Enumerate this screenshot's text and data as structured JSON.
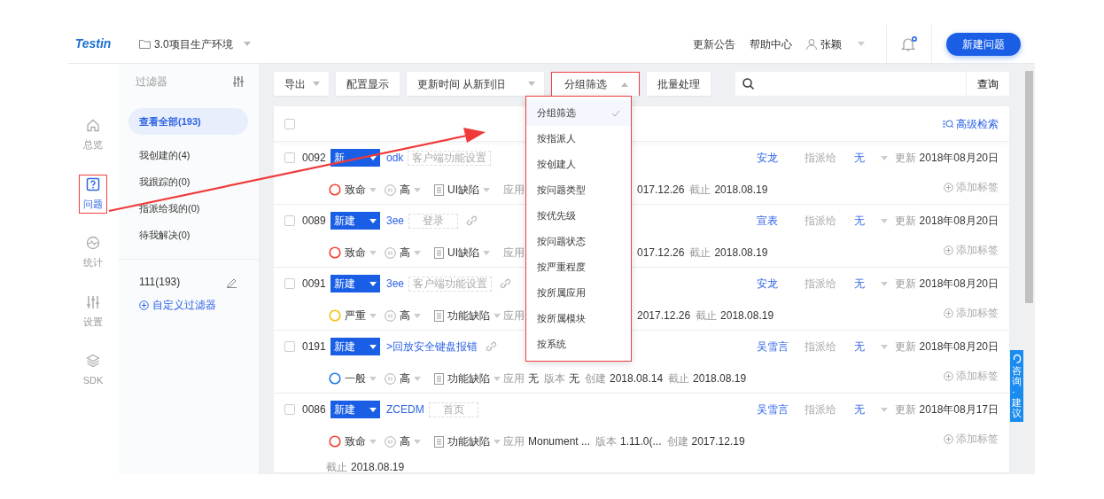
{
  "header": {
    "logo": "Testin",
    "project": "3.0项目生产环境",
    "links": [
      "更新公告",
      "帮助中心"
    ],
    "user": "张颖",
    "notification_dot": true,
    "new_button": "新建问题"
  },
  "nav": [
    {
      "label": "总览",
      "selected": false,
      "highlighted": false
    },
    {
      "label": "问题",
      "selected": true,
      "highlighted": true
    },
    {
      "label": "统计",
      "selected": false,
      "highlighted": false
    },
    {
      "label": "设置",
      "selected": false,
      "highlighted": false
    },
    {
      "label": "SDK",
      "selected": false,
      "highlighted": false
    }
  ],
  "filters": {
    "title": "过滤器",
    "items": [
      {
        "label": "查看全部(193)",
        "selected": true
      },
      {
        "label": "我创建的(4)",
        "selected": false
      },
      {
        "label": "我跟踪的(0)",
        "selected": false
      },
      {
        "label": "指派给我的(0)",
        "selected": false
      },
      {
        "label": "待我解决(0)",
        "selected": false
      }
    ],
    "custom": [
      {
        "label": "111(193)"
      }
    ],
    "add_label": "自定义过滤器"
  },
  "toolbar": {
    "buttons": [
      {
        "label": "导出",
        "kind": "dropdown"
      },
      {
        "label": "配置显示",
        "kind": "plain"
      },
      {
        "label": "更新时间 从新到旧",
        "kind": "dropdown"
      },
      {
        "label": "分组筛选",
        "kind": "open"
      },
      {
        "label": "批量处理",
        "kind": "plain"
      }
    ],
    "search_button": "查询",
    "advanced_search": "高级检索",
    "select_all_checked": false
  },
  "group_menu": {
    "highlighted": true,
    "items": [
      {
        "label": "分组筛选",
        "selected": true
      },
      {
        "label": "按指派人",
        "selected": false
      },
      {
        "label": "按创建人",
        "selected": false
      },
      {
        "label": "按问题类型",
        "selected": false
      },
      {
        "label": "按优先级",
        "selected": false
      },
      {
        "label": "按问题状态",
        "selected": false
      },
      {
        "label": "按严重程度",
        "selected": false
      },
      {
        "label": "按所属应用",
        "selected": false
      },
      {
        "label": "按所属模块",
        "selected": false
      },
      {
        "label": "按系统",
        "selected": false
      }
    ]
  },
  "issues": [
    {
      "checked": false,
      "id": "0092",
      "status": "新",
      "title": "odk",
      "module": "客户端功能设置",
      "link": false,
      "severity": {
        "label": "致命",
        "color": "#f5412e"
      },
      "priority": "高",
      "type": "UI缺陷",
      "meta": [
        {
          "label": "应用"
        },
        {
          "value": "017.12.26",
          "after_menu": true
        },
        {
          "label": "截止",
          "value": "2018.08.19",
          "after_menu": true
        }
      ],
      "assignee": "安龙",
      "assign_label": "指派给",
      "assigned": "无",
      "updated_label": "更新",
      "updated": "2018年08月20日",
      "add_tag": "添加标签"
    },
    {
      "checked": false,
      "id": "0089",
      "status": "新建",
      "title": "3ee",
      "module": "登录",
      "link": true,
      "severity": {
        "label": "致命",
        "color": "#f5412e"
      },
      "priority": "高",
      "type": "UI缺陷",
      "meta": [
        {
          "label": "应用"
        },
        {
          "value": "017.12.26",
          "after_menu": true
        },
        {
          "label": "截止",
          "value": "2018.08.19",
          "after_menu": true
        }
      ],
      "assignee": "宣表",
      "assign_label": "指派给",
      "assigned": "无",
      "updated_label": "更新",
      "updated": "2018年08月20日",
      "add_tag": "添加标签"
    },
    {
      "checked": false,
      "id": "0091",
      "status": "新建",
      "title": "3ee",
      "module": "客户端功能设置",
      "link": true,
      "severity": {
        "label": "严重",
        "color": "#fabe0a"
      },
      "priority": "高",
      "type": "功能缺陷",
      "meta": [
        {
          "label": "应用"
        },
        {
          "value": "2017.12.26",
          "after_menu": true
        },
        {
          "label": "截止",
          "value": "2018.08.19",
          "after_menu": true
        }
      ],
      "assignee": "安龙",
      "assign_label": "指派给",
      "assigned": "无",
      "updated_label": "更新",
      "updated": "2018年08月20日",
      "add_tag": "添加标签"
    },
    {
      "checked": false,
      "id": "0191",
      "status": "新建",
      "title": ">回放安全键盘报错",
      "link": true,
      "severity": {
        "label": "一般",
        "color": "#1f7bea"
      },
      "priority": "高",
      "type": "功能缺陷",
      "meta": [
        {
          "label": "应用",
          "value": "无"
        },
        {
          "label": "版本",
          "value": "无"
        },
        {
          "label": "创建",
          "value": "2018.08.14"
        },
        {
          "label": "截止",
          "value": "2018.08.19"
        }
      ],
      "assignee": "吴雪言",
      "assign_label": "指派给",
      "assigned": "无",
      "updated_label": "更新",
      "updated": "2018年08月20日",
      "add_tag": "添加标签"
    },
    {
      "checked": false,
      "id": "0086",
      "status": "新建",
      "title": "ZCEDM",
      "module": "首页",
      "link": false,
      "severity": {
        "label": "致命",
        "color": "#f5412e"
      },
      "priority": "高",
      "type": "功能缺陷",
      "meta": [
        {
          "label": "应用",
          "value": "Monument ..."
        },
        {
          "label": "版本",
          "value": "1.11.0(..."
        },
        {
          "label": "创建",
          "value": "2017.12.19"
        },
        {
          "label": "截止",
          "value": "2018.08.19",
          "wrapped": true
        }
      ],
      "assignee": "吴雪言",
      "assign_label": "指派给",
      "assigned": "无",
      "updated_label": "更新",
      "updated": "2018年08月17日",
      "add_tag": "添加标签"
    }
  ],
  "feedback_tab": "咨询·建议"
}
